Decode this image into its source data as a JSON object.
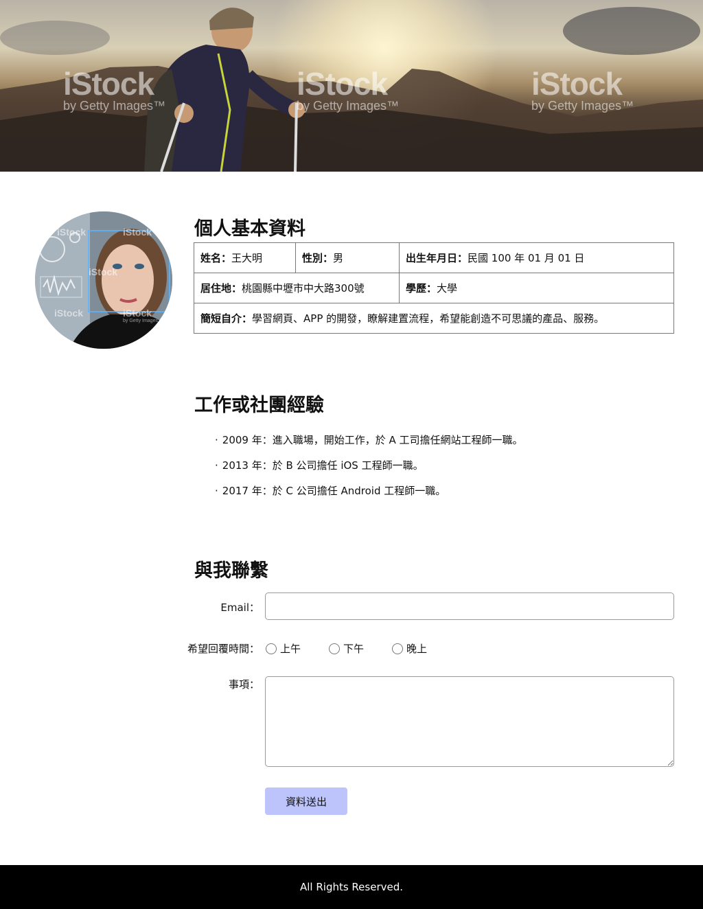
{
  "banner": {
    "watermark_brand": "iStock",
    "watermark_sub": "by Getty Images™"
  },
  "avatar": {
    "watermark_brand": "iStock",
    "watermark_sub": "by Getty Images"
  },
  "profile": {
    "heading": "個人基本資料",
    "name_label": "姓名：",
    "name_value": "王大明",
    "gender_label": "性別：",
    "gender_value": "男",
    "birth_label": "出生年月日：",
    "birth_value": "民國 100 年 01 月 01 日",
    "address_label": "居住地：",
    "address_value": "桃園縣中壢市中大路300號",
    "education_label": "學歷：",
    "education_value": "大學",
    "bio_label": "簡短自介：",
    "bio_value": "學習網頁、APP 的開發，瞭解建置流程，希望能創造不可思議的產品、服務。"
  },
  "experience": {
    "heading": "工作或社團經驗",
    "items": [
      "2009 年：進入職場，開始工作，於 A 工司擔任網站工程師一職。",
      "2013 年：於 B 公司擔任 iOS 工程師一職。",
      "2017 年：於 C 公司擔任 Android 工程師一職。"
    ]
  },
  "contact": {
    "heading": "與我聯繫",
    "email_label": "Email：",
    "email_value": "",
    "reply_time_label": "希望回覆時間：",
    "reply_options": [
      "上午",
      "下午",
      "晚上"
    ],
    "notes_label": "事項：",
    "notes_value": "",
    "submit_label": "資料送出"
  },
  "footer": {
    "text": "All Rights Reserved."
  },
  "colors": {
    "submit_button": "#bcc4fb",
    "footer_bg": "#000000"
  }
}
